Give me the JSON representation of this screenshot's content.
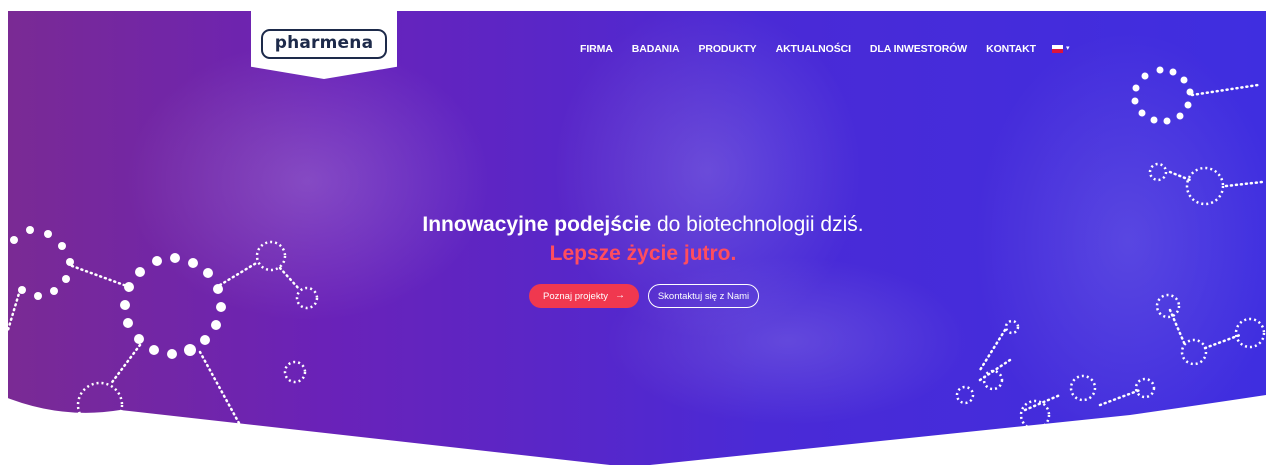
{
  "brand": {
    "logo_text": "pharmena"
  },
  "nav": {
    "items": [
      {
        "label": "FIRMA"
      },
      {
        "label": "BADANIA"
      },
      {
        "label": "PRODUKTY"
      },
      {
        "label": "AKTUALNOŚCI"
      },
      {
        "label": "DLA INWESTORÓW"
      },
      {
        "label": "KONTAKT"
      }
    ],
    "language": {
      "flag_colors": [
        "#ffffff",
        "#dc143c"
      ]
    }
  },
  "hero": {
    "headline_bold": "Innowacyjne podejście",
    "headline_rest": " do biotechnologii dziś.",
    "subline": "Lepsze życie jutro.",
    "primary_button": "Poznaj projekty",
    "secondary_button": "Skontaktuj się z Nami"
  },
  "colors": {
    "accent_red": "#f0384f",
    "subline_red": "#ff4d5e",
    "logo_navy": "#1d2a4a"
  }
}
